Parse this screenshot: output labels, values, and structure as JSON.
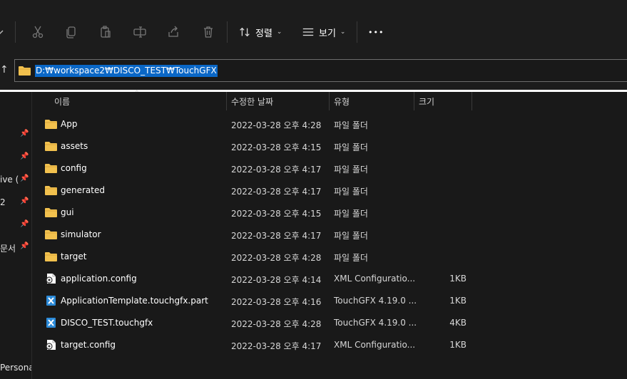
{
  "toolbar": {
    "sort_label": "정렬",
    "view_label": "보기",
    "more_label": "•••"
  },
  "address": {
    "path": "D:₩workspace2₩DISCO_TEST₩TouchGFX"
  },
  "nav": {
    "items": [
      {
        "label": "",
        "pinned": true
      },
      {
        "label": "",
        "pinned": true
      },
      {
        "label": "ive (",
        "pinned": true
      },
      {
        "label": "2",
        "pinned": true
      },
      {
        "label": "",
        "pinned": true
      },
      {
        "label": "문서",
        "pinned": true
      },
      {
        "label": "Persona",
        "pinned": false
      }
    ]
  },
  "columns": {
    "name": "이름",
    "date": "수정한 날짜",
    "type": "유형",
    "size": "크기"
  },
  "files": [
    {
      "name": "App",
      "date": "2022-03-28 오후 4:28",
      "type": "파일 폴더",
      "size": "",
      "icon": "folder-icon"
    },
    {
      "name": "assets",
      "date": "2022-03-28 오후 4:15",
      "type": "파일 폴더",
      "size": "",
      "icon": "folder-icon"
    },
    {
      "name": "config",
      "date": "2022-03-28 오후 4:17",
      "type": "파일 폴더",
      "size": "",
      "icon": "folder-icon"
    },
    {
      "name": "generated",
      "date": "2022-03-28 오후 4:17",
      "type": "파일 폴더",
      "size": "",
      "icon": "folder-icon"
    },
    {
      "name": "gui",
      "date": "2022-03-28 오후 4:15",
      "type": "파일 폴더",
      "size": "",
      "icon": "folder-icon"
    },
    {
      "name": "simulator",
      "date": "2022-03-28 오후 4:17",
      "type": "파일 폴더",
      "size": "",
      "icon": "folder-icon"
    },
    {
      "name": "target",
      "date": "2022-03-28 오후 4:28",
      "type": "파일 폴더",
      "size": "",
      "icon": "folder-icon"
    },
    {
      "name": "application.config",
      "date": "2022-03-28 오후 4:14",
      "type": "XML Configuratio...",
      "size": "1KB",
      "icon": "config-file-icon"
    },
    {
      "name": "ApplicationTemplate.touchgfx.part",
      "date": "2022-03-28 오후 4:16",
      "type": "TouchGFX 4.19.0 ...",
      "size": "1KB",
      "icon": "touchgfx-file-icon"
    },
    {
      "name": "DISCO_TEST.touchgfx",
      "date": "2022-03-28 오후 4:28",
      "type": "TouchGFX 4.19.0 ...",
      "size": "4KB",
      "icon": "touchgfx-file-icon"
    },
    {
      "name": "target.config",
      "date": "2022-03-28 오후 4:17",
      "type": "XML Configuratio...",
      "size": "1KB",
      "icon": "config-file-icon"
    }
  ],
  "colors": {
    "background": "#191919",
    "selection": "#0a67c6",
    "folder": "#f2c14e"
  }
}
